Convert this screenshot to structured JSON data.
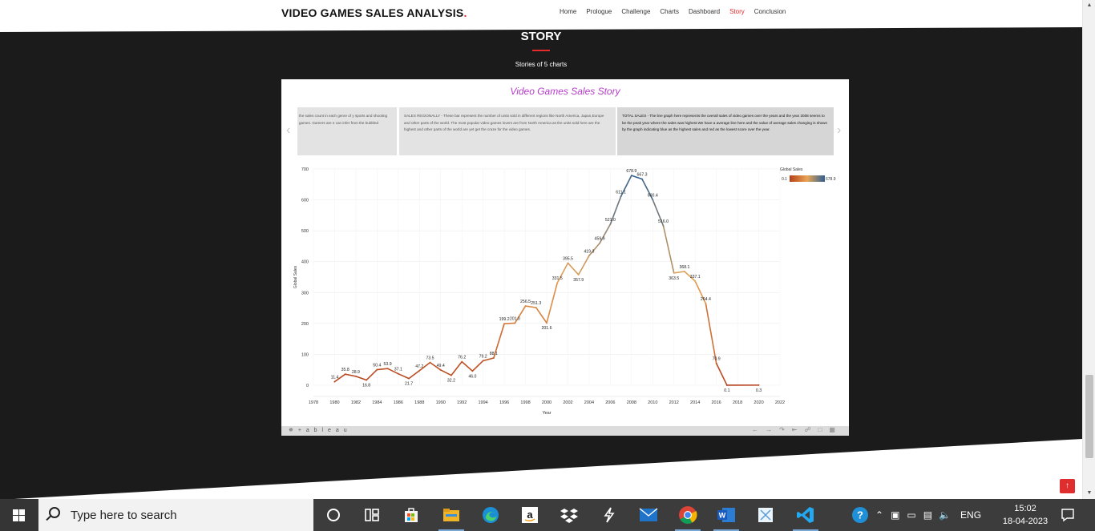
{
  "site": {
    "brand": "VIDEO GAMES SALES ANALYSIS",
    "brand_dot": ".",
    "nav": [
      "Home",
      "Prologue",
      "Challenge",
      "Charts",
      "Dashboard",
      "Story",
      "Conclusion"
    ],
    "active_nav": "Story",
    "accent_color": "#e52a2a"
  },
  "section": {
    "title": "STORY",
    "subtitle": "Stories of 5 charts"
  },
  "tableau": {
    "title": "Video Games Sales Story",
    "captions": [
      "the sales count in each genre of y sports and shooting games. Gamers are e can infer from the bubbled",
      "SALES REGIONALLY - These bar represent the number of units sold in different regions like North America, Japan,Europe and other parts of the world. The most popular video games lovers are from North America as the units sold here are the highest and other parts of the world are yet get the craze for the video games.",
      "TOTAL SALES - The line graph here represents the overall sales of video games over the years and the year 2008 seems to be the peak year where the sales was highest.We have a average line here and the value of average sales changing is shown by the graph indicating blue as the highest sales and red as the lowest score over the year."
    ],
    "footer_logo": "+ a b l e a u"
  },
  "chart_data": {
    "type": "line",
    "title": "",
    "xlabel": "Year",
    "ylabel": "Global Sales",
    "xlim": [
      1978,
      2022
    ],
    "ylim": [
      0,
      700
    ],
    "x_ticks": [
      1978,
      1980,
      1982,
      1984,
      1986,
      1988,
      1990,
      1992,
      1994,
      1996,
      1998,
      2000,
      2002,
      2004,
      2006,
      2008,
      2010,
      2012,
      2014,
      2016,
      2018,
      2020,
      2022
    ],
    "y_ticks": [
      0,
      100,
      200,
      300,
      400,
      500,
      600,
      700
    ],
    "grid": true,
    "legend": {
      "title": "Global Sales",
      "min_label": "0.1",
      "max_label": "678.9",
      "placement": "top-right"
    },
    "color_scale": {
      "low": "#b5401a",
      "mid": "#e8a455",
      "high": "#2e5f92"
    },
    "points": [
      {
        "x": 1980,
        "y": 11.4,
        "label": "11.4"
      },
      {
        "x": 1981,
        "y": 35.8,
        "label": "35.8"
      },
      {
        "x": 1982,
        "y": 28.9,
        "label": "28.9"
      },
      {
        "x": 1983,
        "y": 16.8,
        "label": "16.8"
      },
      {
        "x": 1984,
        "y": 50.4,
        "label": "50.4"
      },
      {
        "x": 1985,
        "y": 53.9,
        "label": "53.9"
      },
      {
        "x": 1986,
        "y": 37.1,
        "label": "37.1"
      },
      {
        "x": 1987,
        "y": 21.7,
        "label": "21.7"
      },
      {
        "x": 1988,
        "y": 47.2,
        "label": "47.2"
      },
      {
        "x": 1989,
        "y": 73.5,
        "label": "73.5"
      },
      {
        "x": 1990,
        "y": 49.4,
        "label": "49.4"
      },
      {
        "x": 1991,
        "y": 32.2,
        "label": "32.2"
      },
      {
        "x": 1992,
        "y": 76.2,
        "label": "76.2"
      },
      {
        "x": 1993,
        "y": 46.0,
        "label": "46.0"
      },
      {
        "x": 1994,
        "y": 79.2,
        "label": "79.2"
      },
      {
        "x": 1995,
        "y": 88.1,
        "label": "88.1"
      },
      {
        "x": 1996,
        "y": 199.2,
        "label": "199.2"
      },
      {
        "x": 1997,
        "y": 201.0,
        "label": "201.0"
      },
      {
        "x": 1998,
        "y": 256.5,
        "label": "256.5"
      },
      {
        "x": 1999,
        "y": 251.3,
        "label": "251.3"
      },
      {
        "x": 2000,
        "y": 201.6,
        "label": "201.6"
      },
      {
        "x": 2001,
        "y": 331.5,
        "label": "331.5"
      },
      {
        "x": 2002,
        "y": 395.5,
        "label": "395.5"
      },
      {
        "x": 2003,
        "y": 357.9,
        "label": "357.9"
      },
      {
        "x": 2004,
        "y": 419.3,
        "label": "419.3"
      },
      {
        "x": 2005,
        "y": 459.9,
        "label": "459.9"
      },
      {
        "x": 2006,
        "y": 521.0,
        "label": "521.0"
      },
      {
        "x": 2007,
        "y": 611.1,
        "label": "611.1"
      },
      {
        "x": 2008,
        "y": 678.9,
        "label": "678.9"
      },
      {
        "x": 2009,
        "y": 667.3,
        "label": "667.3"
      },
      {
        "x": 2010,
        "y": 600.4,
        "label": "600.4"
      },
      {
        "x": 2011,
        "y": 516.0,
        "label": "516.0"
      },
      {
        "x": 2012,
        "y": 363.5,
        "label": "363.5"
      },
      {
        "x": 2013,
        "y": 368.1,
        "label": "368.1"
      },
      {
        "x": 2014,
        "y": 337.1,
        "label": "337.1"
      },
      {
        "x": 2015,
        "y": 264.4,
        "label": "264.4"
      },
      {
        "x": 2016,
        "y": 70.9,
        "label": "70.9"
      },
      {
        "x": 2017,
        "y": 0.1,
        "label": "0.1"
      },
      {
        "x": 2020,
        "y": 0.3,
        "label": "0.3"
      }
    ]
  },
  "taskbar": {
    "search_placeholder": "Type here to search",
    "language": "ENG",
    "time": "15:02",
    "date": "18-04-2023",
    "apps": [
      "cortana-circle",
      "task-view",
      "microsoft-store",
      "file-explorer",
      "edge",
      "amazon",
      "dropbox",
      "plugin-app",
      "mail",
      "chrome",
      "word",
      "snipping-tool",
      "vscode"
    ]
  }
}
